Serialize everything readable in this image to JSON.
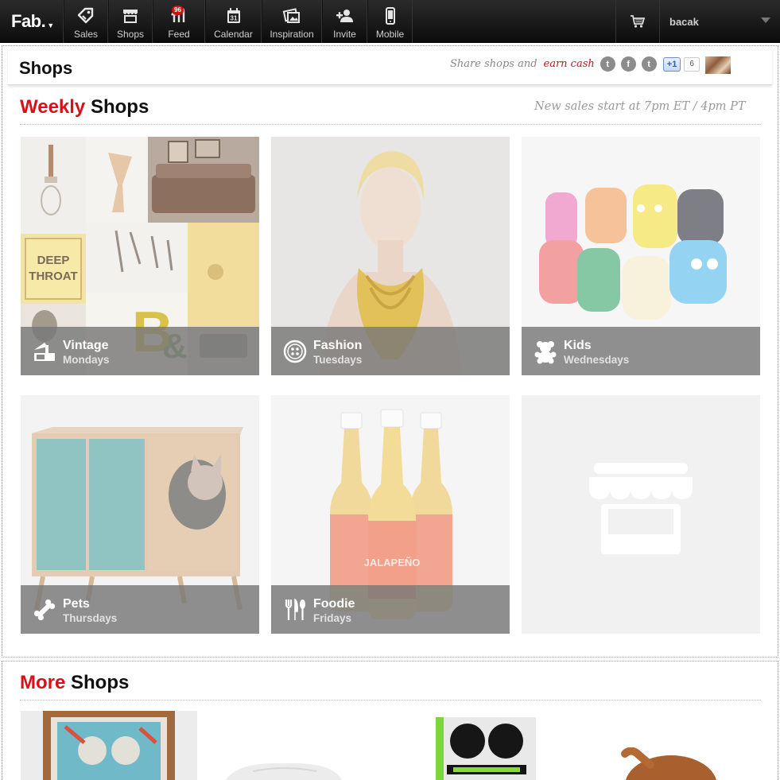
{
  "nav": {
    "logo": "Fab.",
    "items": [
      {
        "label": "Sales",
        "icon": "tag-icon"
      },
      {
        "label": "Shops",
        "icon": "storefront-icon"
      },
      {
        "label": "Feed",
        "icon": "feed-icon",
        "badge": "96"
      },
      {
        "label": "Calendar",
        "icon": "calendar-icon",
        "date": "31"
      },
      {
        "label": "Inspiration",
        "icon": "photos-icon"
      },
      {
        "label": "Invite",
        "icon": "add-person-icon"
      },
      {
        "label": "Mobile",
        "icon": "phone-icon"
      }
    ],
    "cart_icon": "cart-icon",
    "username": "bacak"
  },
  "header": {
    "title": "Shops",
    "share_prefix": "Share shops and",
    "share_link": "earn cash",
    "social": [
      "twitter-icon",
      "facebook-icon",
      "tumblr-icon"
    ],
    "social_glyphs": [
      "t",
      "f",
      "t"
    ],
    "plusone_label": "+1",
    "plusone_count": "6"
  },
  "weekly": {
    "title_red": "Weekly",
    "title_black": "Shops",
    "note": "New sales start at 7pm ET / 4pm PT",
    "tiles": [
      {
        "name": "Vintage",
        "day": "Mondays",
        "icon": "gramophone-icon"
      },
      {
        "name": "Fashion",
        "day": "Tuesdays",
        "icon": "button-icon"
      },
      {
        "name": "Kids",
        "day": "Wednesdays",
        "icon": "teddy-bear-icon"
      },
      {
        "name": "Pets",
        "day": "Thursdays",
        "icon": "bone-icon"
      },
      {
        "name": "Foodie",
        "day": "Fridays",
        "icon": "utensils-icon"
      }
    ]
  },
  "more": {
    "title_red": "More",
    "title_black": "Shops"
  },
  "colors": {
    "accent": "#d8101a",
    "nav_bg": "#1a1a1a",
    "overlay": "#787878"
  }
}
